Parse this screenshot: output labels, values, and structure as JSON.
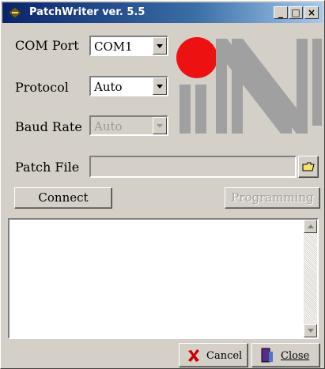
{
  "window": {
    "title": "PatchWriter ver. 5.5"
  },
  "caption_buttons": {
    "minimize": "_",
    "maximize": "□",
    "close": "×"
  },
  "settings": {
    "com_port": {
      "label": "COM Port",
      "value": "COM1"
    },
    "protocol": {
      "label": "Protocol",
      "value": "Auto"
    },
    "baud_rate": {
      "label": "Baud Rate",
      "value": "Auto",
      "disabled": true
    }
  },
  "patch_file": {
    "label": "Patch File",
    "value": ""
  },
  "actions": {
    "connect": "Connect",
    "programming": "Programming"
  },
  "footer": {
    "cancel": "Cancel",
    "close": "Close"
  },
  "logo": {
    "dot_color": "#ee1111",
    "shape_color": "#a0a0a0"
  },
  "icons": [
    "app-icon",
    "folder-icon",
    "cancel-x-icon",
    "close-door-icon"
  ]
}
